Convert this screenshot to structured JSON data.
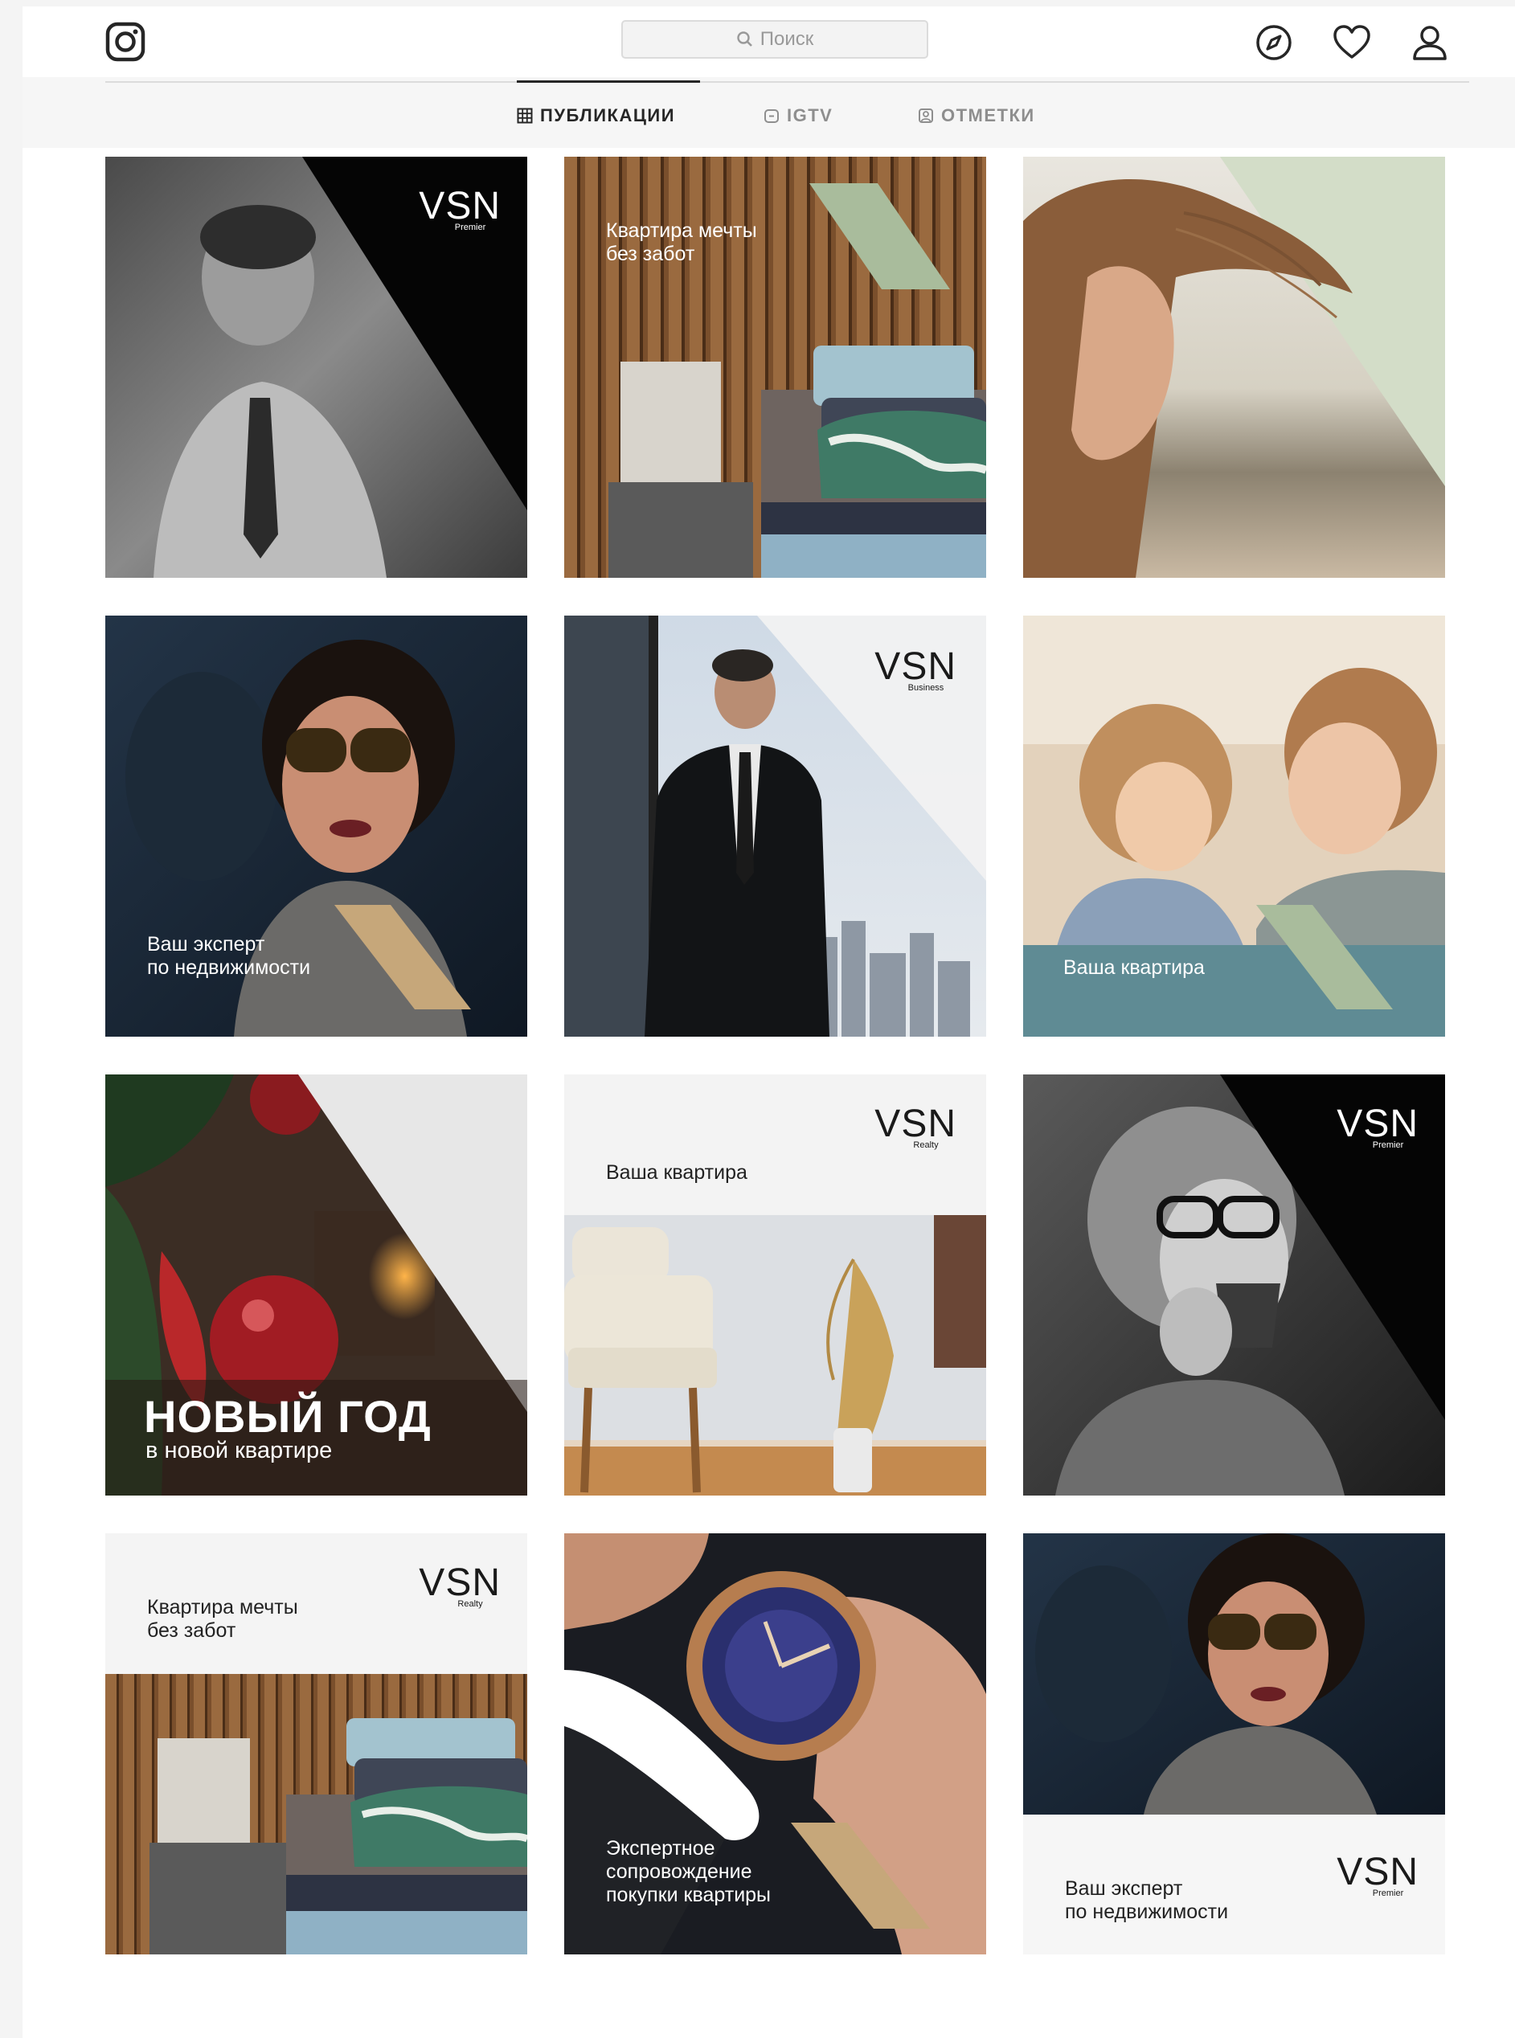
{
  "header": {
    "search_placeholder": "Поиск",
    "logo_icon": "instagram-icon",
    "nav_icons": [
      "explore-compass-icon",
      "heart-icon",
      "profile-icon"
    ]
  },
  "tabs": [
    {
      "label": "ПУБЛИКАЦИИ",
      "icon": "grid-icon",
      "active": true
    },
    {
      "label": "IGTV",
      "icon": "igtv-icon",
      "active": false
    },
    {
      "label": "ОТМЕТКИ",
      "icon": "tagged-icon",
      "active": false
    }
  ],
  "posts": [
    {
      "id": 1,
      "logo": "VSN",
      "logo_sub": "Premier"
    },
    {
      "id": 2,
      "caption": "Квартира мечты\nбез забот"
    },
    {
      "id": 3
    },
    {
      "id": 4,
      "caption": "Ваш эксперт\nпо недвижимости"
    },
    {
      "id": 5,
      "logo": "VSN",
      "logo_sub": "Business"
    },
    {
      "id": 6,
      "caption": "Ваша квартира"
    },
    {
      "id": 7,
      "title": "НОВЫЙ ГОД",
      "subtitle": "в новой квартире"
    },
    {
      "id": 8,
      "caption": "Ваша квартира",
      "logo": "VSN",
      "logo_sub": "Realty"
    },
    {
      "id": 9,
      "logo": "VSN",
      "logo_sub": "Premier"
    },
    {
      "id": 10,
      "caption": "Квартира мечты\nбез забот",
      "logo": "VSN",
      "logo_sub": "Realty"
    },
    {
      "id": 11,
      "caption": "Экспертное\nсопровождение\nпокупки квартиры"
    },
    {
      "id": 12,
      "caption": "Ваш эксперт\nпо недвижимости",
      "logo": "VSN",
      "logo_sub": "Premier"
    }
  ],
  "colors": {
    "sage": "#a9bc9c",
    "gold": "#c6a77a",
    "ink": "#262626"
  }
}
